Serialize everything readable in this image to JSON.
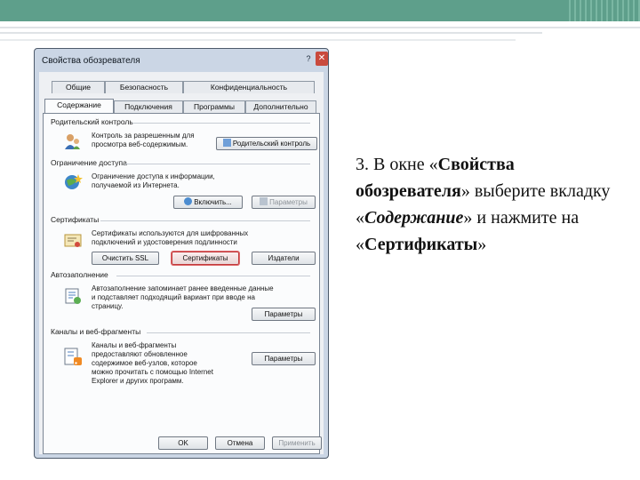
{
  "window": {
    "title": "Свойства обозревателя",
    "help_label": "?",
    "close_label": "✕"
  },
  "tabs": {
    "row_top": [
      "Общие",
      "Безопасность",
      "Конфиденциальность"
    ],
    "row_bottom": [
      "Содержание",
      "Подключения",
      "Программы",
      "Дополнительно"
    ],
    "active": "Содержание"
  },
  "groups": {
    "parental": {
      "title": "Родительский контроль",
      "description": "Контроль за разрешенным для просмотра веб-содержимым.",
      "button": "Родительский контроль",
      "icon": "parental-control-icon"
    },
    "access": {
      "title": "Ограничение доступа",
      "description": "Ограничение доступа к информации, получаемой из Интернета.",
      "enable_button": "Включить...",
      "params_button": "Параметры",
      "icon": "globe-star-icon"
    },
    "certificates": {
      "title": "Сертификаты",
      "description": "Сертификаты используются для шифрованных подключений и удостоверения подлинности",
      "clear_ssl_button": "Очистить SSL",
      "certificates_button": "Сертификаты",
      "publishers_button": "Издатели",
      "icon": "certificate-icon"
    },
    "autocomplete": {
      "title": "Автозаполнение",
      "description": "Автозаполнение запоминает ранее введенные данные и подставляет подходящий вариант при вводе на страницу.",
      "params_button": "Параметры",
      "icon": "autocomplete-icon"
    },
    "feeds": {
      "title": "Каналы и веб-фрагменты",
      "description": "Каналы и веб-фрагменты предоставляют обновленное содержимое веб-узлов, которое можно прочитать с помощью Internet Explorer и других программ.",
      "params_button": "Параметры",
      "icon": "feeds-icon"
    }
  },
  "footer": {
    "ok": "OK",
    "cancel": "Отмена",
    "apply": "Применить"
  },
  "slide": {
    "part1": "3. В окне «",
    "bold1": "Свойства обозревателя",
    "part2": "» выберите вкладку  «",
    "bold2": "Содержание",
    "part3": "» и нажмите  на «",
    "bold3": "Сертификаты",
    "part4": "»"
  },
  "colors": {
    "slide_accent": "#5e9f8b",
    "highlight_border": "#c0393b"
  }
}
